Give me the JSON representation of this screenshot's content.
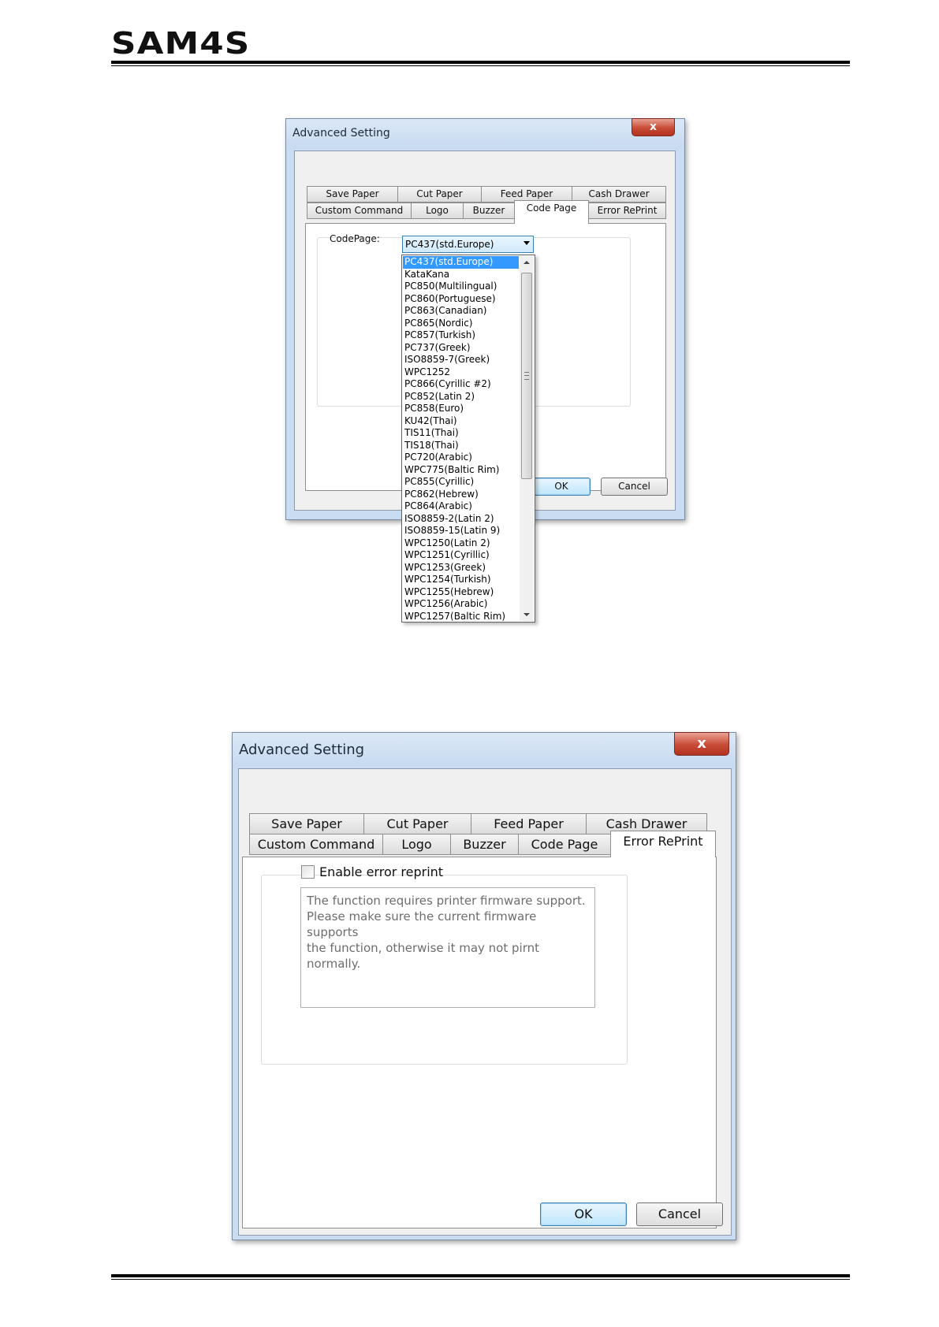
{
  "brand": {
    "logo_text": "SAM4S"
  },
  "dialog1": {
    "title": "Advanced Setting",
    "close_glyph": "x",
    "tabs_row1": [
      "Save Paper",
      "Cut Paper",
      "Feed Paper",
      "Cash Drawer"
    ],
    "tabs_row2": [
      "Custom Command",
      "Logo",
      "Buzzer",
      "Code Page",
      "Error RePrint"
    ],
    "active_tab": "Code Page",
    "codepage_label": "CodePage:",
    "codepage_selected": "PC437(std.Europe)",
    "codepage_options": [
      "PC437(std.Europe)",
      "KataKana",
      "PC850(Multilingual)",
      "PC860(Portuguese)",
      "PC863(Canadian)",
      "PC865(Nordic)",
      "PC857(Turkish)",
      "PC737(Greek)",
      "ISO8859-7(Greek)",
      "WPC1252",
      "PC866(Cyrillic #2)",
      "PC852(Latin 2)",
      "PC858(Euro)",
      "KU42(Thai)",
      "TIS11(Thai)",
      "TIS18(Thai)",
      "PC720(Arabic)",
      "WPC775(Baltic Rim)",
      "PC855(Cyrillic)",
      "PC862(Hebrew)",
      "PC864(Arabic)",
      "ISO8859-2(Latin 2)",
      "ISO8859-15(Latin 9)",
      "WPC1250(Latin 2)",
      "WPC1251(Cyrillic)",
      "WPC1253(Greek)",
      "WPC1254(Turkish)",
      "WPC1255(Hebrew)",
      "WPC1256(Arabic)",
      "WPC1257(Baltic Rim)"
    ],
    "ok_label": "OK",
    "cancel_label": "Cancel"
  },
  "dialog2": {
    "title": "Advanced Setting",
    "close_glyph": "x",
    "tabs_row1": [
      "Save Paper",
      "Cut Paper",
      "Feed Paper",
      "Cash Drawer"
    ],
    "tabs_row2": [
      "Custom Command",
      "Logo",
      "Buzzer",
      "Code Page",
      "Error RePrint"
    ],
    "active_tab": "Error RePrint",
    "enable_label": "Enable error reprint",
    "enable_checked": false,
    "note_lines": [
      "The function requires printer firmware support.",
      "Please make sure the current firmware supports",
      "the function, otherwise it may not pirnt normally."
    ],
    "ok_label": "OK",
    "cancel_label": "Cancel"
  }
}
